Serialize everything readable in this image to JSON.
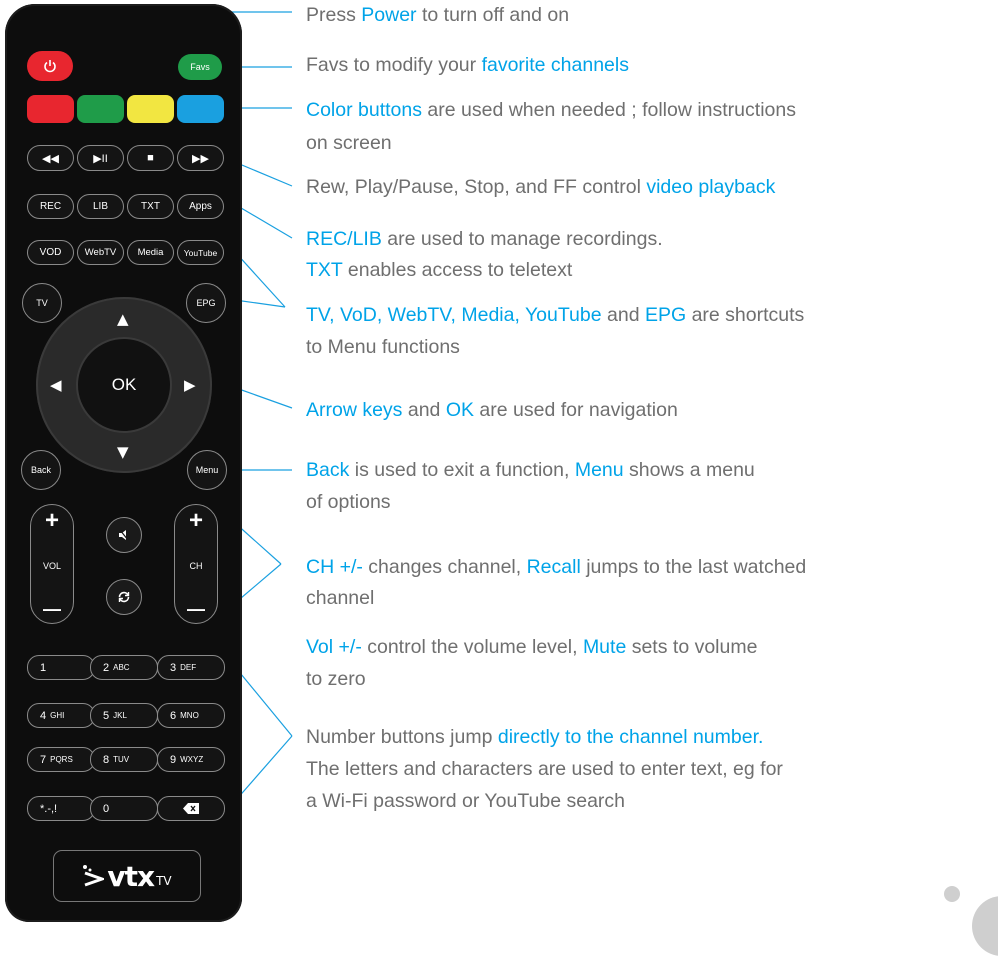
{
  "remote": {
    "power_icon": "power-icon",
    "favs": "Favs",
    "transport": [
      "◀◀",
      "▶II",
      "■",
      "▶▶"
    ],
    "row_rec": [
      "REC",
      "LIB",
      "TXT",
      "Apps"
    ],
    "row_vod": [
      "VOD",
      "WebTV",
      "Media",
      "YouTube"
    ],
    "tv": "TV",
    "epg": "EPG",
    "ok": "OK",
    "back": "Back",
    "menu": "Menu",
    "vol": "VOL",
    "ch": "CH",
    "plus": "+",
    "minus": "—",
    "mute_icon": "mute-icon",
    "recall_icon": "recall-icon",
    "numbers": [
      {
        "main": "1",
        "sub": ""
      },
      {
        "main": "2",
        "sub": "ABC"
      },
      {
        "main": "3",
        "sub": "DEF"
      },
      {
        "main": "4",
        "sub": "GHI"
      },
      {
        "main": "5",
        "sub": "JKL"
      },
      {
        "main": "6",
        "sub": "MNO"
      },
      {
        "main": "7",
        "sub": "PQRS"
      },
      {
        "main": "8",
        "sub": "TUV"
      },
      {
        "main": "9",
        "sub": "WXYZ"
      },
      {
        "main": "*.-,!",
        "sub": ""
      },
      {
        "main": "0",
        "sub": ""
      }
    ],
    "brand": "vtx",
    "brand_sub": "TV",
    "colors": {
      "red": "#e8262f",
      "green": "#1f9c49",
      "yellow": "#f2e641",
      "blue": "#1aa0e0",
      "favs_green": "#1f9c49"
    }
  },
  "annotations": {
    "power": {
      "a": "Press ",
      "b": "Power",
      "c": " to turn off and on"
    },
    "favs": {
      "a": "Favs to modify your ",
      "b": "favorite channels"
    },
    "color_1": {
      "b": "Color buttons",
      "c": " are used when needed ; follow instructions"
    },
    "color_2": "on screen",
    "transport": {
      "a": "Rew, Play/Pause, Stop, and FF control ",
      "b": "video playback"
    },
    "rec_1": {
      "b": "REC/LIB",
      "c": " are used to manage recordings."
    },
    "rec_2": {
      "b": "TXT",
      "c": " enables access to teletext"
    },
    "shortcuts_1": {
      "b": "TV, VoD, WebTV, Media, YouTube",
      "c": " and ",
      "d": "EPG",
      "e": " are shortcuts"
    },
    "shortcuts_2": "to Menu functions",
    "arrows": {
      "b": "Arrow keys",
      "c": " and ",
      "d": "OK",
      "e": " are used for navigation"
    },
    "back_1": {
      "b": "Back",
      "c": " is used to exit a function, ",
      "d": "Menu",
      "e": " shows a menu"
    },
    "back_2": "of options",
    "ch_1": {
      "b": "CH +/-",
      "c": " changes channel, ",
      "d": "Recall",
      "e": " jumps to the last watched"
    },
    "ch_2": "channel",
    "vol_1": {
      "b": "Vol +/-",
      "c": " control the volume level, ",
      "d": "Mute",
      "e": " sets to volume"
    },
    "vol_2": "to zero",
    "num_1": {
      "a": "Number buttons jump ",
      "b": "directly to the channel number."
    },
    "num_2": "The letters and characters are used to enter text, eg for",
    "num_3": "a Wi-Fi password or YouTube search"
  },
  "accent": "#00a3e8",
  "text_color": "#6f6f6f"
}
